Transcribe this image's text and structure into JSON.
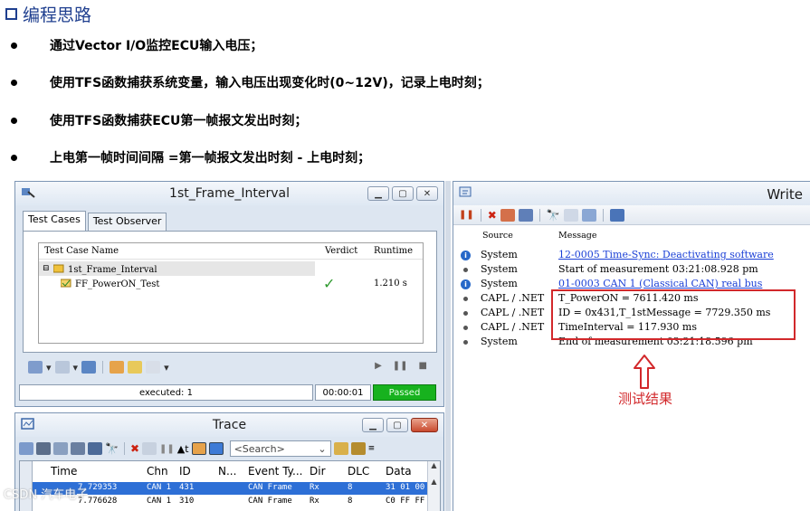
{
  "slide": {
    "title": "编程思路",
    "bullets": [
      "通过Vector I/O监控ECU输入电压；",
      "使用TFS函数捕获系统变量，输入电压出现变化时(0~12V)，记录上电时刻；",
      "使用TFS函数捕获ECU第一帧报文发出时刻；",
      "上电第一帧时间间隔 =第一帧报文发出时刻 - 上电时刻；"
    ]
  },
  "test_window": {
    "title": "1st_Frame_Interval",
    "tabs": [
      "Test Cases",
      "Test Observer"
    ],
    "columns": {
      "name": "Test Case Name",
      "verdict": "Verdict",
      "runtime": "Runtime"
    },
    "rows": [
      {
        "name": "1st_Frame_Interval",
        "verdict": "",
        "runtime": ""
      },
      {
        "name": "FF_PowerON_Test",
        "verdict": "✓",
        "runtime": "1.210 s"
      }
    ],
    "status": {
      "executed": "executed: 1",
      "time": "00:00:01",
      "result": "Passed"
    }
  },
  "trace_window": {
    "title": "Trace",
    "search_placeholder": "<Search>",
    "columns": [
      "Time",
      "Chn",
      "ID",
      "N...",
      "Event Ty...",
      "Dir",
      "DLC",
      "Data"
    ],
    "rows": [
      {
        "time": "7.729353",
        "chn": "CAN 1",
        "id": "431",
        "name": "",
        "event": "CAN Frame",
        "dir": "Rx",
        "dlc": "8",
        "data": "31 01 00"
      },
      {
        "time": "7.776628",
        "chn": "CAN 1",
        "id": "310",
        "name": "",
        "event": "CAN Frame",
        "dir": "Rx",
        "dlc": "8",
        "data": "C0 FF FF"
      }
    ],
    "watermark": "CSDN 汽车电子"
  },
  "write_window": {
    "title": "Write",
    "columns": {
      "source": "Source",
      "message": "Message"
    },
    "rows": [
      {
        "icon": "info",
        "source": "System",
        "message": "12-0005 Time-Sync: Deactivating software",
        "link": true
      },
      {
        "icon": "dot",
        "source": "System",
        "message": "Start of measurement 03:21:08.928 pm",
        "link": false
      },
      {
        "icon": "info",
        "source": "System",
        "message": "01-0003 CAN 1 (Classical CAN)  real bus",
        "link": true
      },
      {
        "icon": "dot",
        "source": "CAPL / .NET",
        "message": "T_PowerON = 7611.420 ms",
        "link": false
      },
      {
        "icon": "dot",
        "source": "CAPL / .NET",
        "message": "ID = 0x431,T_1stMessage = 7729.350 ms",
        "link": false
      },
      {
        "icon": "dot",
        "source": "CAPL / .NET",
        "message": "TimeInterval = 117.930 ms",
        "link": false
      },
      {
        "icon": "dot",
        "source": "System",
        "message": "End of measurement 03:21:18.596 pm",
        "link": false
      }
    ],
    "annotation": "测试结果"
  },
  "colors": {
    "title_blue": "#1f3f8f",
    "pass_green": "#17b21e",
    "highlight_red": "#d2282b",
    "selection_blue": "#2d6fd6"
  }
}
